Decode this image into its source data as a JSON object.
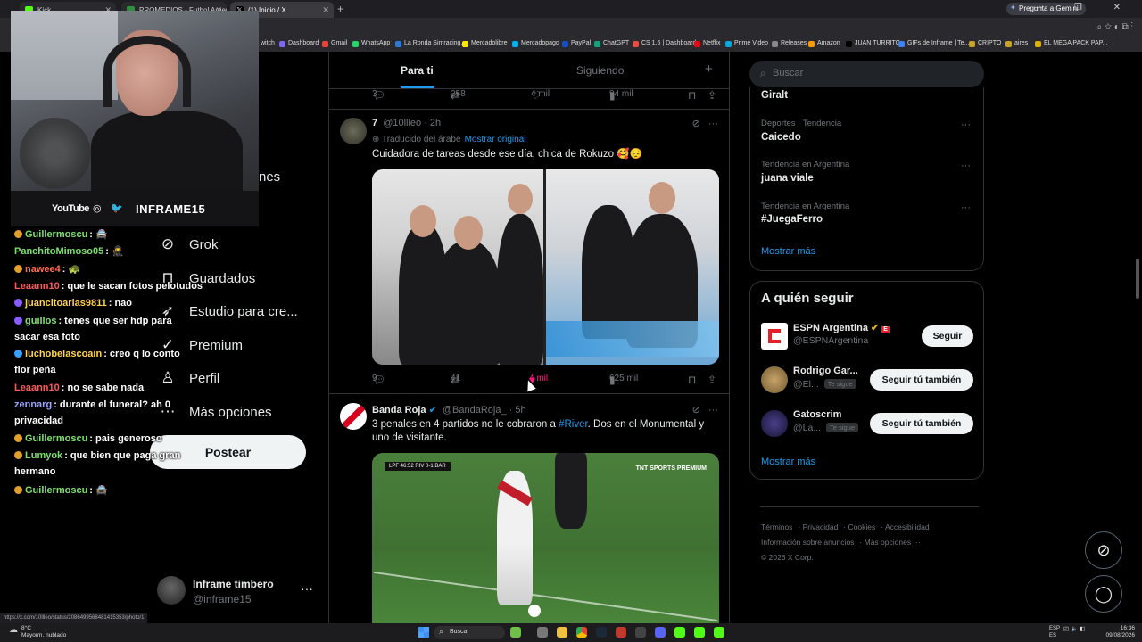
{
  "browser": {
    "tabs": [
      {
        "label": "Kick",
        "color": "#53fc18"
      },
      {
        "label": "PROMEDIOS - Futbol Argentin",
        "color": "#2f8f3f"
      },
      {
        "label": "(1) Inicio / X",
        "color": "#e7e9ea"
      }
    ],
    "gemini_label": "Pregunta a Gemini",
    "window_controls": "— ❐ ✕",
    "toolbar_icons": "⌕ ☆ ◐ ⧉ ⋮",
    "bookmarks": [
      "witch",
      "Dashboard",
      "Gmail",
      "WhatsApp",
      "La Ronda Simracing...",
      "Mercadolibre",
      "Mercadopago",
      "PayPal",
      "ChatGPT",
      "CS 1.6 | Dashboard",
      "Netflix",
      "Prime Video",
      "Releases",
      "Amazon",
      "JUAN TURRITO",
      "GIFs de Inframe | Te...",
      "CRIPTO",
      "aires",
      "EL MEGA PACK PAP..."
    ]
  },
  "webcam": {
    "youtube": "YouTube",
    "instagram_icon": "instagram-icon",
    "twitter_icon": "twitter-icon",
    "channel": "INFRAME15"
  },
  "nav": {
    "partial_label": "nes",
    "items": [
      {
        "icon": "⊘",
        "label": "Grok"
      },
      {
        "icon": "⊓",
        "label": "Guardados"
      },
      {
        "icon": "➶",
        "label": "Estudio para cre..."
      },
      {
        "icon": "✓",
        "label": "Premium"
      },
      {
        "icon": "♙",
        "label": "Perfil"
      },
      {
        "icon": "⋯",
        "label": "Más opciones"
      }
    ],
    "post_label": "Postear",
    "account": {
      "name": "Inframe timbero",
      "handle": "@inframe15",
      "more": "···"
    }
  },
  "chat": [
    {
      "user": "Guillermoscu",
      "text": ": 🚔",
      "color": "#7ee06e"
    },
    {
      "user": "PanchitoMimoso05",
      "text": ": 🥷",
      "color": "#7ee06e"
    },
    {
      "user": "nawee4",
      "text": ": 🐢",
      "color": "#ff6a4d"
    },
    {
      "user": "Leaann10",
      "text": ": que le sacan fotos pelotudos",
      "color": "#ff5a5a"
    },
    {
      "user": "juancitoarias9811",
      "text": ": nao",
      "color": "#ffd24d"
    },
    {
      "user": "guillos",
      "text": ": tenes que ser hdp para",
      "color": "#7ee06e"
    },
    {
      "user": "",
      "text": "sacar esa foto",
      "color": "#ffffff"
    },
    {
      "user": "luchobelascoain",
      "text": ": creo q lo conto",
      "color": "#ffd24d"
    },
    {
      "user": "",
      "text": "flor peña",
      "color": "#ffffff"
    },
    {
      "user": "Leaann10",
      "text": ": no se sabe nada",
      "color": "#ff5a5a"
    },
    {
      "user": "zennarg",
      "text": ": durante el funeral? ah 0",
      "color": "#9aa3ff"
    },
    {
      "user": "",
      "text": "privacidad",
      "color": "#ffffff"
    },
    {
      "user": "Guillermoscu",
      "text": ": pais generoso",
      "color": "#7ee06e"
    },
    {
      "user": "Lumyok",
      "text": ": que bien que paga gran",
      "color": "#7ee06e"
    },
    {
      "user": "",
      "text": "hermano",
      "color": "#ffffff"
    },
    {
      "user": "Guillermoscu",
      "text": ": 🚔",
      "color": "#7ee06e"
    }
  ],
  "timeline": {
    "tab_for_you": "Para ti",
    "tab_following": "Siguiendo",
    "add_icon": "+",
    "top_actions": {
      "replies": "3",
      "reposts": "258",
      "likes": "4 mil",
      "views": "94 mil"
    },
    "tweet1": {
      "name": "7",
      "handle": "@10llleo · 2h",
      "translated": "Traducido del árabe",
      "show_original": "Mostrar original",
      "text": "Cuidadora de tareas desde ese día, chica de Rokuzo 🥰😔",
      "actions": {
        "replies": "9",
        "reposts": "41",
        "likes": "4 mil",
        "views": "625 mil"
      }
    },
    "tweet2": {
      "name": "Banda Roja",
      "handle": "@BandaRoja_ · 5h",
      "text_before": "3 penales en 4 partidos no le cobraron a ",
      "hashtag": "#River",
      "text_after": ". Dos en el Monumental y uno de visitante.",
      "scorebug": "LPF  46:52  RIV 0-1 BAR",
      "broadcaster": "TNT SPORTS PREMIUM"
    }
  },
  "sidebar": {
    "search_placeholder": "Buscar",
    "trends": [
      {
        "meta": "",
        "title": "Giralt"
      },
      {
        "meta": "Deportes · Tendencia",
        "title": "Caicedo"
      },
      {
        "meta": "Tendencia en Argentina",
        "title": "juana viale"
      },
      {
        "meta": "Tendencia en Argentina",
        "title": "#JuegaFerro"
      }
    ],
    "trends_more": "Mostrar más",
    "who_to_follow": "A quién seguir",
    "suggestions": [
      {
        "name": "ESPN Argentina",
        "handle": "@ESPNArgentina",
        "badge": "",
        "button": "Seguir"
      },
      {
        "name": "Rodrigo Gar...",
        "handle": "@El...",
        "badge": "Te sigue",
        "button": "Seguir tú también"
      },
      {
        "name": "Gatoscrim",
        "handle": "@La...",
        "badge": "Te sigue",
        "button": "Seguir tú también"
      }
    ],
    "follow_more": "Mostrar más",
    "footer": [
      "Términos",
      "Privacidad",
      "Cookies",
      "Accesibilidad",
      "Información sobre anuncios",
      "Más opciones ···",
      "© 2026 X Corp."
    ]
  },
  "status_url": "https://x.com/10llleo/status/2086499568481415353/photo/1",
  "taskbar": {
    "weather_temp": "8°C",
    "weather_desc": "Mayorm. nublado",
    "search": "Buscar",
    "lang": "ESP",
    "lang2": "ES",
    "time": "16:36",
    "date": "09/08/2026"
  }
}
